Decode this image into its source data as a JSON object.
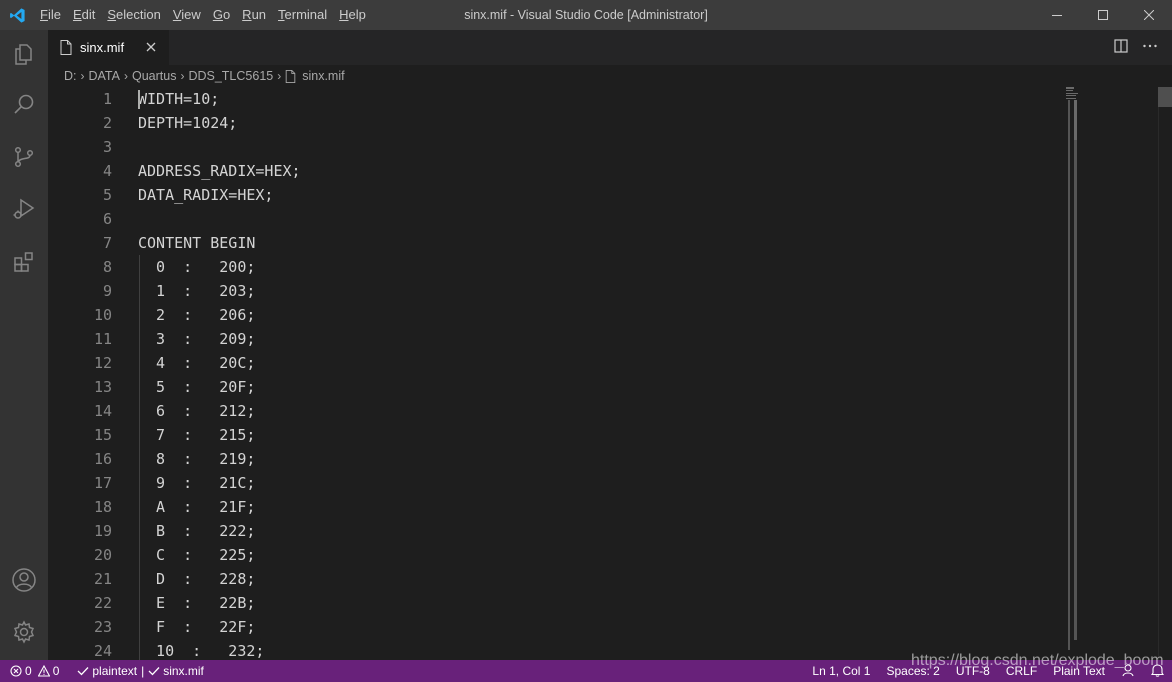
{
  "window": {
    "title": "sinx.mif - Visual Studio Code [Administrator]",
    "menu": [
      {
        "pre": "",
        "u": "F",
        "post": "ile"
      },
      {
        "pre": "",
        "u": "E",
        "post": "dit"
      },
      {
        "pre": "",
        "u": "S",
        "post": "election"
      },
      {
        "pre": "",
        "u": "V",
        "post": "iew"
      },
      {
        "pre": "",
        "u": "G",
        "post": "o"
      },
      {
        "pre": "",
        "u": "R",
        "post": "un"
      },
      {
        "pre": "",
        "u": "T",
        "post": "erminal"
      },
      {
        "pre": "",
        "u": "H",
        "post": "elp"
      }
    ]
  },
  "activity_bar": {
    "icons": [
      "explorer-icon",
      "search-icon",
      "source-control-icon",
      "run-debug-icon",
      "extensions-icon",
      "accounts-icon",
      "manage-gear-icon"
    ]
  },
  "tab": {
    "label": "sinx.mif"
  },
  "breadcrumb": {
    "parts": [
      "D:",
      "DATA",
      "Quartus",
      "DDS_TLC5615"
    ],
    "file": "sinx.mif"
  },
  "editor": {
    "lines": [
      {
        "no": "1",
        "text": "WIDTH=10;"
      },
      {
        "no": "2",
        "text": "DEPTH=1024;"
      },
      {
        "no": "3",
        "text": ""
      },
      {
        "no": "4",
        "text": "ADDRESS_RADIX=HEX;"
      },
      {
        "no": "5",
        "text": "DATA_RADIX=HEX;"
      },
      {
        "no": "6",
        "text": ""
      },
      {
        "no": "7",
        "text": "CONTENT BEGIN"
      },
      {
        "no": "8",
        "text": "  0  :   200;"
      },
      {
        "no": "9",
        "text": "  1  :   203;"
      },
      {
        "no": "10",
        "text": "  2  :   206;"
      },
      {
        "no": "11",
        "text": "  3  :   209;"
      },
      {
        "no": "12",
        "text": "  4  :   20C;"
      },
      {
        "no": "13",
        "text": "  5  :   20F;"
      },
      {
        "no": "14",
        "text": "  6  :   212;"
      },
      {
        "no": "15",
        "text": "  7  :   215;"
      },
      {
        "no": "16",
        "text": "  8  :   219;"
      },
      {
        "no": "17",
        "text": "  9  :   21C;"
      },
      {
        "no": "18",
        "text": "  A  :   21F;"
      },
      {
        "no": "19",
        "text": "  B  :   222;"
      },
      {
        "no": "20",
        "text": "  C  :   225;"
      },
      {
        "no": "21",
        "text": "  D  :   228;"
      },
      {
        "no": "22",
        "text": "  E  :   22B;"
      },
      {
        "no": "23",
        "text": "  F  :   22F;"
      },
      {
        "no": "24",
        "text": "  10  :   232;"
      }
    ]
  },
  "status": {
    "errors": "0",
    "warnings": "0",
    "language_check": "plaintext",
    "file_check": "sinx.mif",
    "position": "Ln 1, Col 1",
    "spaces": "Spaces: 2",
    "encoding": "UTF-8",
    "eol": "CRLF",
    "language": "Plain Text"
  },
  "watermark": "https://blog.csdn.net/explode_boom",
  "colors": {
    "status_bar": "#68217a",
    "editor_bg": "#1e1e1e",
    "titlebar": "#3c3c3c",
    "activity_bar": "#333333"
  }
}
